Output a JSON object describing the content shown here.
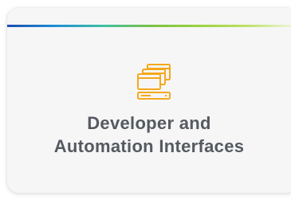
{
  "card": {
    "title_line1": "Developer and",
    "title_line2": "Automation Interfaces",
    "icon": "stacked-windows-server-icon"
  },
  "colors": {
    "accent_gradient": [
      "#1a4fb0",
      "#1f8fd6",
      "#3cc1a0",
      "#7dc242",
      "#9bd33f",
      "#bfe26b",
      "#f2f8e6"
    ],
    "icon": "#f5a81c",
    "title_text": "#555a61",
    "card_background": "#f6f6f7"
  }
}
